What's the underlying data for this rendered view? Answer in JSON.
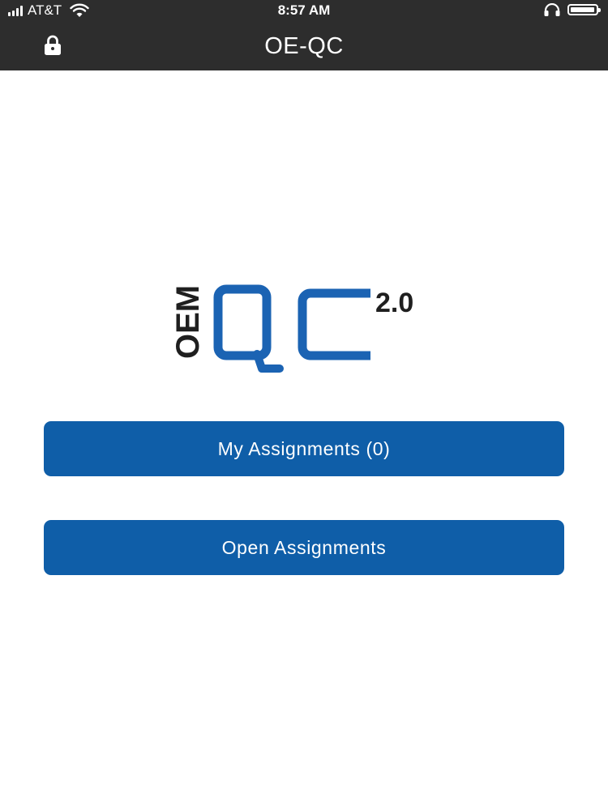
{
  "status_bar": {
    "carrier": "AT&T",
    "time": "8:57 AM",
    "signal_bars": 4,
    "battery_level": 0.95,
    "icons": [
      "signal-icon",
      "wifi-icon",
      "headphone-icon",
      "battery-icon"
    ]
  },
  "nav": {
    "title": "OE-QC",
    "left_icon": "lock-icon"
  },
  "logo": {
    "prefix": "OEM",
    "name": "QC",
    "version": "2.0",
    "colors": {
      "primary": "#1b63b3",
      "text": "#1f1f1f"
    }
  },
  "actions": {
    "my_assignments_label": "My Assignments (0)",
    "open_assignments_label": "Open Assignments"
  },
  "colors": {
    "nav_background": "#2d2d2d",
    "button_background": "#0f5ea8",
    "button_text": "#ffffff",
    "page_background": "#ffffff"
  }
}
